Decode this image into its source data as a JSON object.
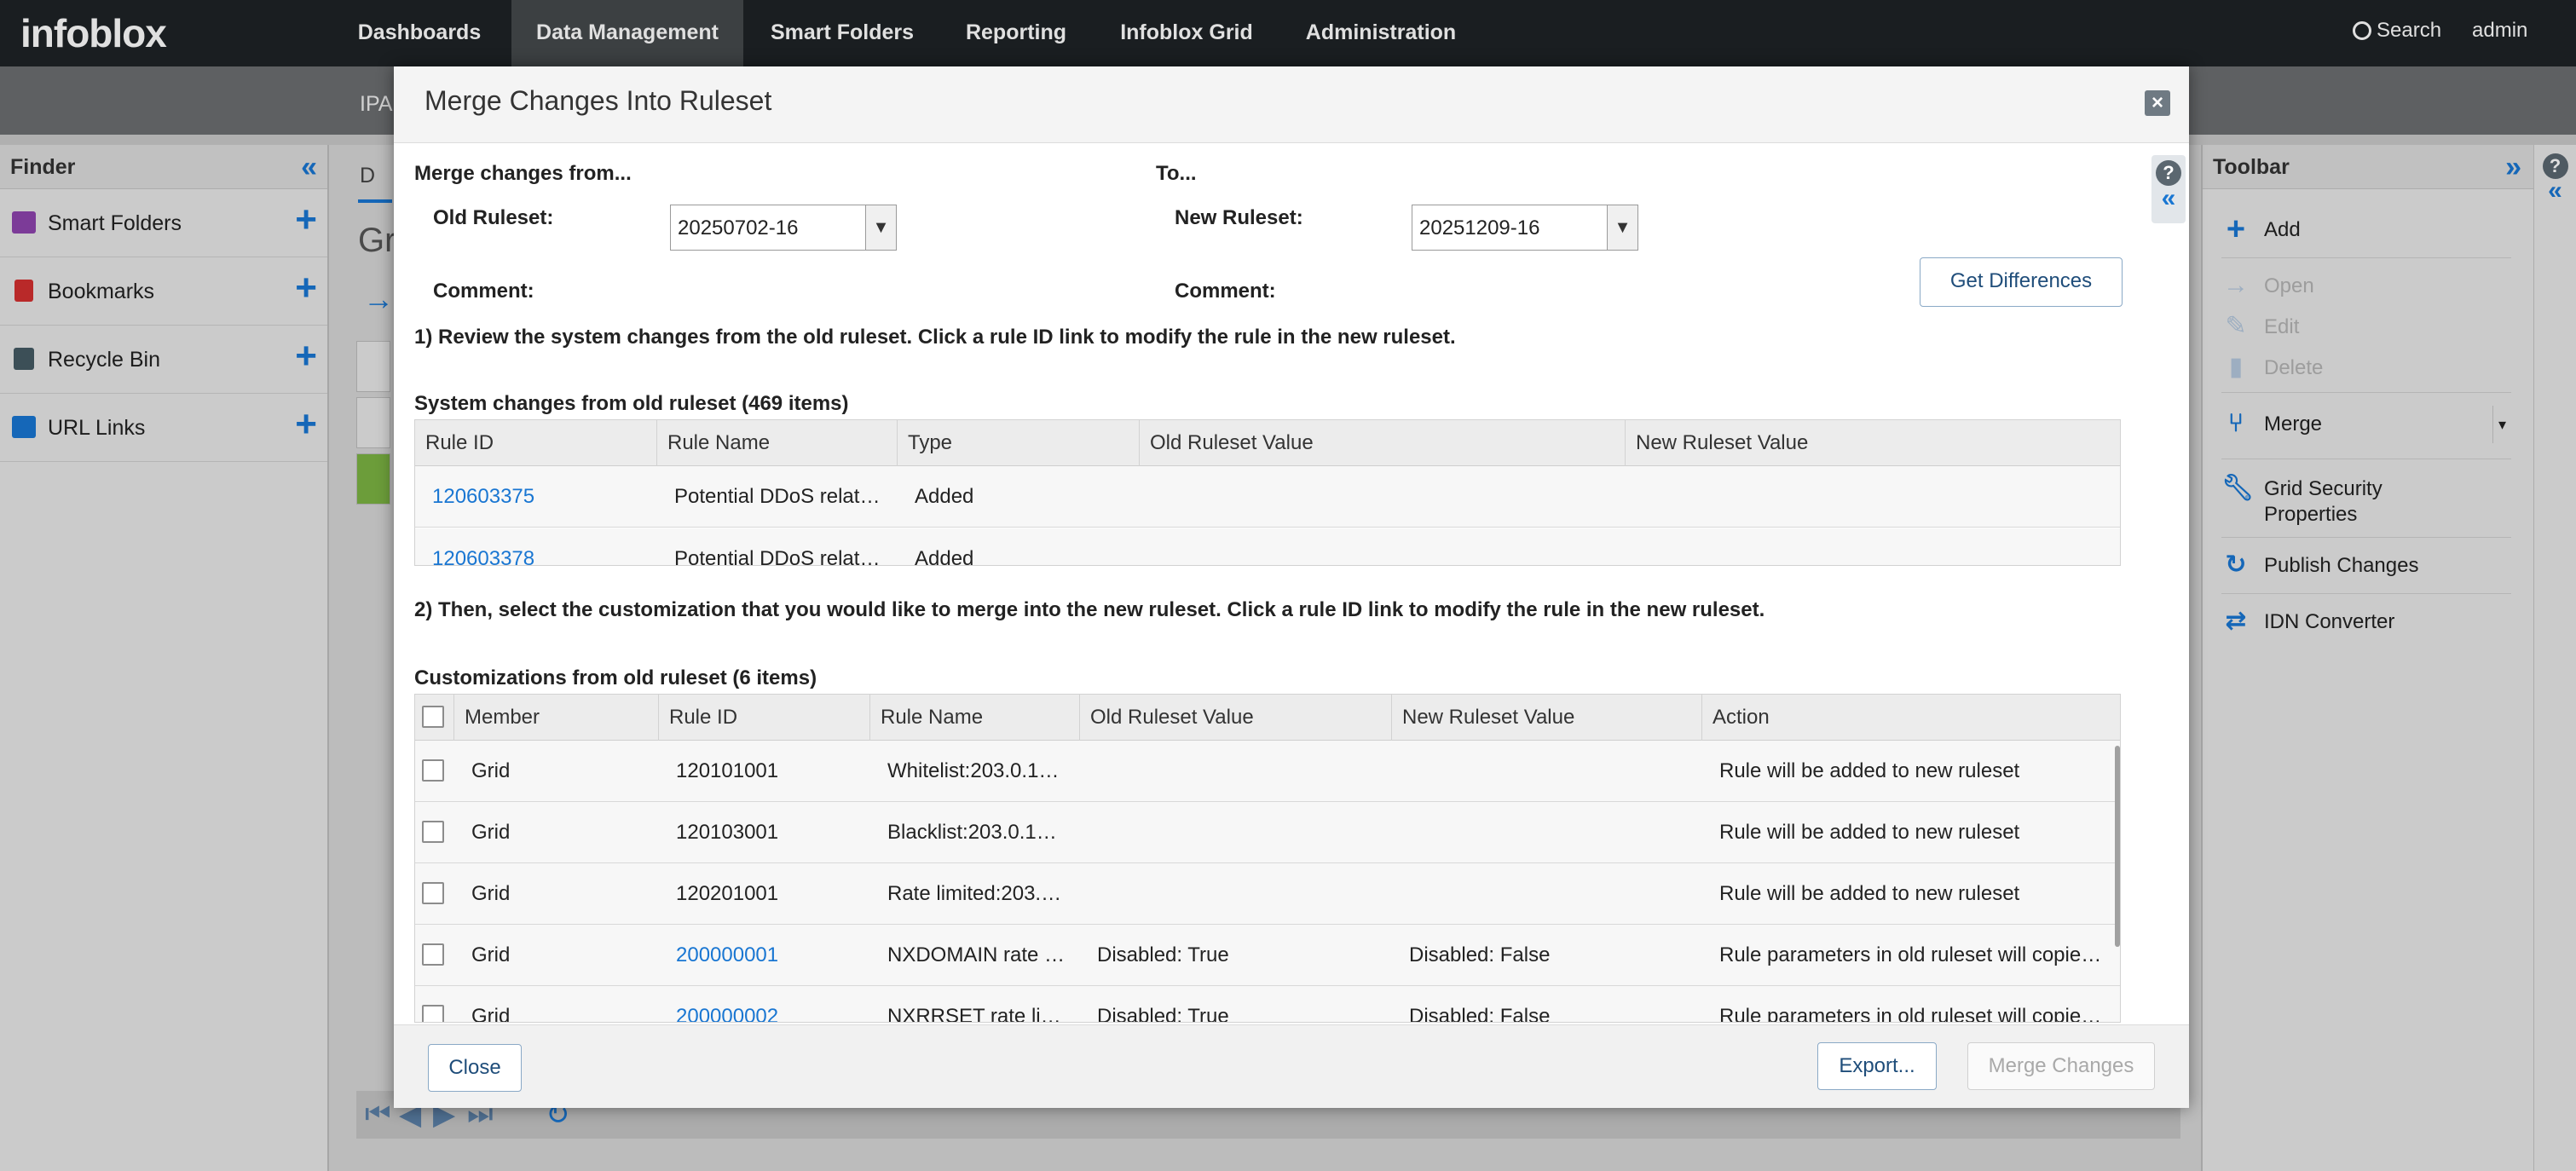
{
  "app": {
    "logo": "infoblox",
    "nav": [
      "Dashboards",
      "Data Management",
      "Smart Folders",
      "Reporting",
      "Infoblox Grid",
      "Administration"
    ],
    "search_label": "Search",
    "user": "admin",
    "subnav_fragment": "IPA"
  },
  "finder": {
    "title": "Finder",
    "items": [
      {
        "label": "Smart Folders",
        "color": "#8e44ad"
      },
      {
        "label": "Bookmarks",
        "color": "#d32f2f"
      },
      {
        "label": "Recycle Bin",
        "color": "#455a64"
      },
      {
        "label": "URL Links",
        "color": "#1976d2"
      }
    ]
  },
  "background": {
    "tab_fragment": "D",
    "heading_fragment": "Gr"
  },
  "toolbar": {
    "title": "Toolbar",
    "add": "Add",
    "open": "Open",
    "edit": "Edit",
    "delete": "Delete",
    "merge": "Merge",
    "grid_security_1": "Grid Security",
    "grid_security_2": "Properties",
    "publish": "Publish Changes",
    "idn": "IDN Converter"
  },
  "dialog": {
    "title": "Merge Changes Into Ruleset",
    "merge_from": "Merge changes from...",
    "to": "To...",
    "old_ruleset_label": "Old Ruleset:",
    "old_ruleset_value": "20250702-16",
    "new_ruleset_label": "New Ruleset:",
    "new_ruleset_value": "20251209-16",
    "comment_label": "Comment:",
    "get_differences": "Get Differences",
    "step1": "1) Review the system changes from the old ruleset. Click a rule ID link to modify the rule in the new ruleset.",
    "system_title": "System changes from old ruleset (469 items)",
    "system_columns": [
      "Rule ID",
      "Rule Name",
      "Type",
      "Old Ruleset Value",
      "New Ruleset Value"
    ],
    "system_rows": [
      {
        "id": "120603375",
        "name": "Potential DDoS relat…",
        "type": "Added",
        "old": "",
        "new": ""
      },
      {
        "id": "120603378",
        "name": "Potential DDoS relat…",
        "type": "Added",
        "old": "",
        "new": ""
      }
    ],
    "step2": "2) Then, select the customization that you would like to merge into the new ruleset. Click a rule ID link to modify the rule in the new ruleset.",
    "custom_title": "Customizations from old ruleset (6 items)",
    "custom_columns": [
      "Member",
      "Rule ID",
      "Rule Name",
      "Old Ruleset Value",
      "New Ruleset Value",
      "Action"
    ],
    "custom_rows": [
      {
        "member": "Grid",
        "id": "120101001",
        "link": false,
        "name": "Whitelist:203.0.1…",
        "old": "",
        "new": "",
        "action": "Rule will be added to new ruleset"
      },
      {
        "member": "Grid",
        "id": "120103001",
        "link": false,
        "name": "Blacklist:203.0.1…",
        "old": "",
        "new": "",
        "action": "Rule will be added to new ruleset"
      },
      {
        "member": "Grid",
        "id": "120201001",
        "link": false,
        "name": "Rate limited:203.…",
        "old": "",
        "new": "",
        "action": "Rule will be added to new ruleset"
      },
      {
        "member": "Grid",
        "id": "200000001",
        "link": true,
        "name": "NXDOMAIN rate …",
        "old": "Disabled: True",
        "new": "Disabled: False",
        "action": "Rule parameters in old ruleset will copie…"
      },
      {
        "member": "Grid",
        "id": "200000002",
        "link": true,
        "name": "NXRRSET rate li…",
        "old": "Disabled: True",
        "new": "Disabled: False",
        "action": "Rule parameters in old ruleset will copie…"
      }
    ],
    "close": "Close",
    "export": "Export...",
    "merge_changes": "Merge Changes"
  }
}
